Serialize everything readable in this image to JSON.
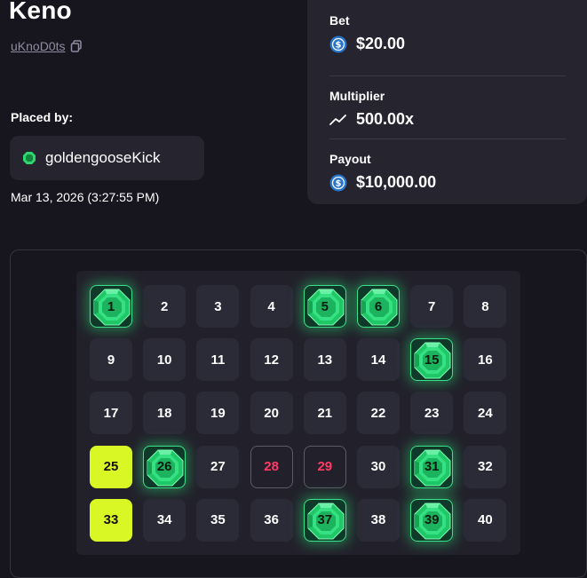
{
  "game": {
    "title": "Keno",
    "id": "uKnoD0ts",
    "placed_by_label": "Placed by:",
    "user": "goldengooseKick",
    "date": "Mar 13, 2026 (3:27:55 PM)"
  },
  "stats": {
    "bet_label": "Bet",
    "bet_value": "$20.00",
    "multiplier_label": "Multiplier",
    "multiplier_value": "500.00x",
    "payout_label": "Payout",
    "payout_value": "$10,000.00"
  },
  "colors": {
    "selected": "#d9f725",
    "hit": "#3ddf8a",
    "miss_text": "#ff3b66"
  },
  "icons": {
    "copy": "copy-icon",
    "coin": "usdc-coin-icon",
    "trend": "trend-up-icon",
    "user": "green-gem-icon"
  },
  "tiles": [
    {
      "n": "1",
      "state": "hit"
    },
    {
      "n": "2",
      "state": "normal"
    },
    {
      "n": "3",
      "state": "normal"
    },
    {
      "n": "4",
      "state": "normal"
    },
    {
      "n": "5",
      "state": "hit"
    },
    {
      "n": "6",
      "state": "hit"
    },
    {
      "n": "7",
      "state": "normal"
    },
    {
      "n": "8",
      "state": "normal"
    },
    {
      "n": "9",
      "state": "normal"
    },
    {
      "n": "10",
      "state": "normal"
    },
    {
      "n": "11",
      "state": "normal"
    },
    {
      "n": "12",
      "state": "normal"
    },
    {
      "n": "13",
      "state": "normal"
    },
    {
      "n": "14",
      "state": "normal"
    },
    {
      "n": "15",
      "state": "hit"
    },
    {
      "n": "16",
      "state": "normal"
    },
    {
      "n": "17",
      "state": "normal"
    },
    {
      "n": "18",
      "state": "normal"
    },
    {
      "n": "19",
      "state": "normal"
    },
    {
      "n": "20",
      "state": "normal"
    },
    {
      "n": "21",
      "state": "normal"
    },
    {
      "n": "22",
      "state": "normal"
    },
    {
      "n": "23",
      "state": "normal"
    },
    {
      "n": "24",
      "state": "normal"
    },
    {
      "n": "25",
      "state": "selected"
    },
    {
      "n": "26",
      "state": "hit"
    },
    {
      "n": "27",
      "state": "normal"
    },
    {
      "n": "28",
      "state": "miss"
    },
    {
      "n": "29",
      "state": "miss"
    },
    {
      "n": "30",
      "state": "normal"
    },
    {
      "n": "31",
      "state": "hit"
    },
    {
      "n": "32",
      "state": "normal"
    },
    {
      "n": "33",
      "state": "selected"
    },
    {
      "n": "34",
      "state": "normal"
    },
    {
      "n": "35",
      "state": "normal"
    },
    {
      "n": "36",
      "state": "normal"
    },
    {
      "n": "37",
      "state": "hit"
    },
    {
      "n": "38",
      "state": "normal"
    },
    {
      "n": "39",
      "state": "hit"
    },
    {
      "n": "40",
      "state": "normal"
    }
  ]
}
